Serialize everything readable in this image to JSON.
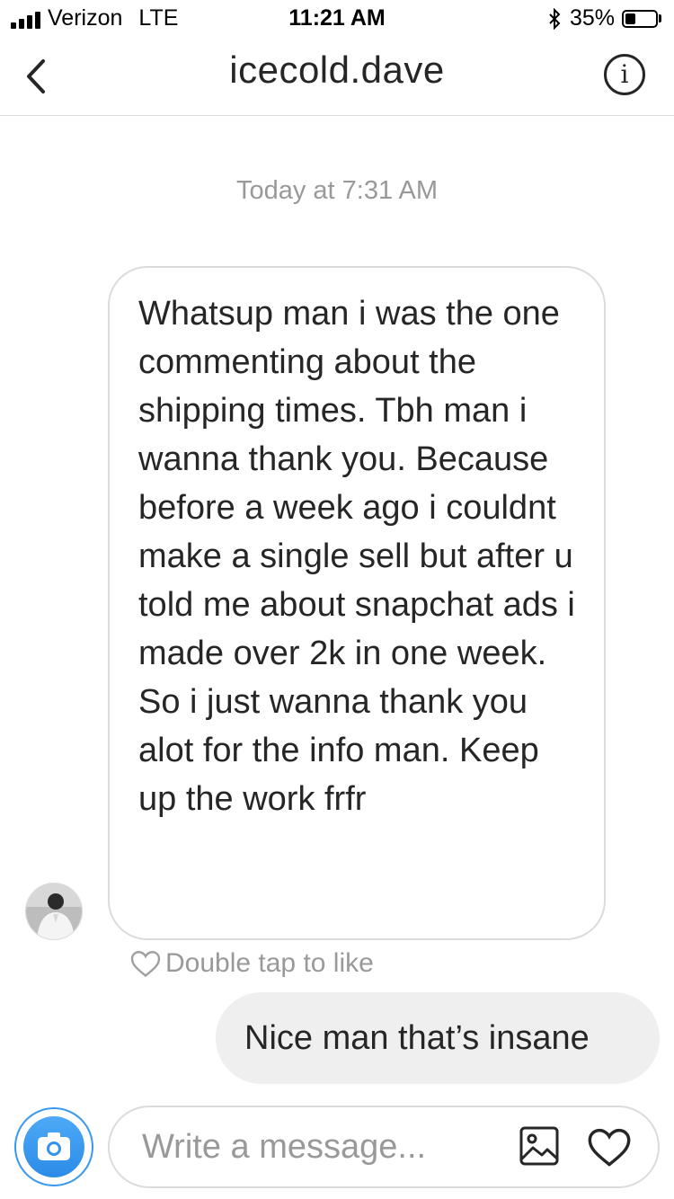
{
  "status_bar": {
    "carrier": "Verizon",
    "network": "LTE",
    "time": "11:21 AM",
    "battery_percent_label": "35%",
    "battery_level": 0.35,
    "signal_bars": 4,
    "icons": [
      "signal-icon",
      "bluetooth-icon",
      "battery-icon"
    ]
  },
  "header": {
    "title": "icecold.dave",
    "back_icon": "chevron-left-icon",
    "info_glyph": "i"
  },
  "conversation": {
    "timestamp": "Today at 7:31 AM",
    "incoming_message": "Whatsup man i was the one commenting about the shipping times. Tbh man i wanna thank you. Because before a week ago i couldnt make a single sell but after u told me about snapchat ads i made over 2k in one week. So i just wanna thank you alot for the info man. Keep up the work frfr",
    "like_hint": "Double tap to like",
    "outgoing_message": "Nice man that’s insane"
  },
  "composer": {
    "placeholder": "Write a message...",
    "icons": [
      "camera-icon",
      "gallery-icon",
      "heart-icon"
    ]
  },
  "colors": {
    "accent_blue": "#3897f0",
    "bubble_border": "#dbdbdb",
    "outgoing_bubble": "#efefef",
    "secondary_text": "#999999",
    "primary_text": "#262626"
  }
}
